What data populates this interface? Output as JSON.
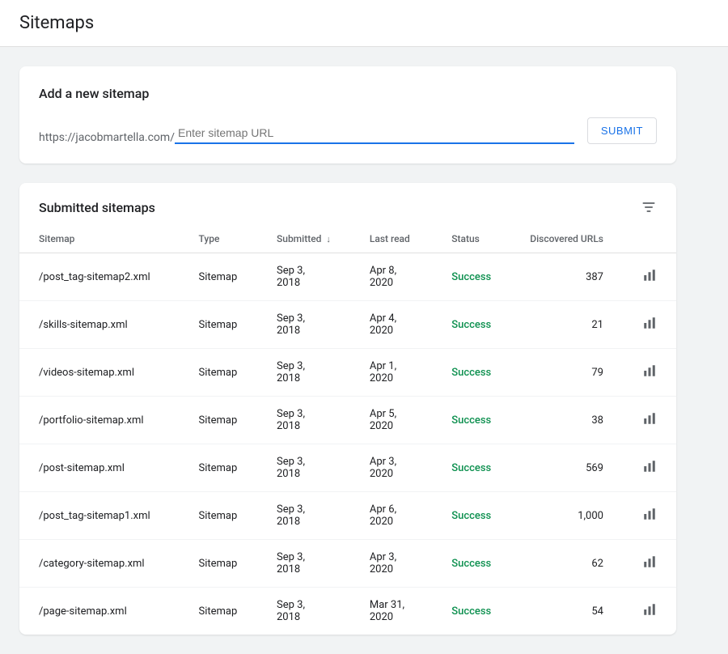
{
  "header": {
    "title": "Sitemaps"
  },
  "add_sitemap": {
    "card_title": "Add a new sitemap",
    "url_prefix": "https://jacobmartella.com/",
    "input_placeholder": "Enter sitemap URL",
    "submit_label": "SUBMIT"
  },
  "submitted_table": {
    "card_title": "Submitted sitemaps",
    "columns": {
      "sitemap": "Sitemap",
      "type": "Type",
      "submitted": "Submitted",
      "last_read": "Last read",
      "status": "Status",
      "discovered_urls": "Discovered URLs"
    },
    "rows": [
      {
        "sitemap": "/post_tag-sitemap2.xml",
        "type": "Sitemap",
        "submitted": "Sep 3, 2018",
        "last_read": "Apr 8, 2020",
        "status": "Success",
        "urls": "387"
      },
      {
        "sitemap": "/skills-sitemap.xml",
        "type": "Sitemap",
        "submitted": "Sep 3, 2018",
        "last_read": "Apr 4, 2020",
        "status": "Success",
        "urls": "21"
      },
      {
        "sitemap": "/videos-sitemap.xml",
        "type": "Sitemap",
        "submitted": "Sep 3, 2018",
        "last_read": "Apr 1, 2020",
        "status": "Success",
        "urls": "79"
      },
      {
        "sitemap": "/portfolio-sitemap.xml",
        "type": "Sitemap",
        "submitted": "Sep 3, 2018",
        "last_read": "Apr 5, 2020",
        "status": "Success",
        "urls": "38"
      },
      {
        "sitemap": "/post-sitemap.xml",
        "type": "Sitemap",
        "submitted": "Sep 3, 2018",
        "last_read": "Apr 3, 2020",
        "status": "Success",
        "urls": "569"
      },
      {
        "sitemap": "/post_tag-sitemap1.xml",
        "type": "Sitemap",
        "submitted": "Sep 3, 2018",
        "last_read": "Apr 6, 2020",
        "status": "Success",
        "urls": "1,000"
      },
      {
        "sitemap": "/category-sitemap.xml",
        "type": "Sitemap",
        "submitted": "Sep 3, 2018",
        "last_read": "Apr 3, 2020",
        "status": "Success",
        "urls": "62"
      },
      {
        "sitemap": "/page-sitemap.xml",
        "type": "Sitemap",
        "submitted": "Sep 3, 2018",
        "last_read": "Mar 31, 2020",
        "status": "Success",
        "urls": "54"
      }
    ]
  }
}
